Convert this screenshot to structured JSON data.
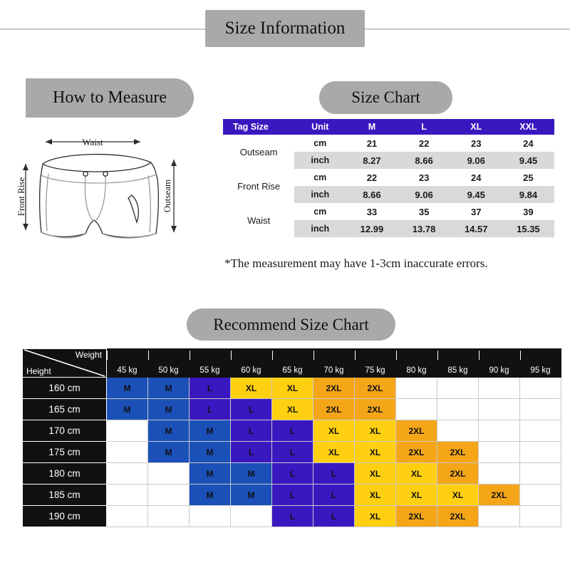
{
  "page": {
    "title": "Size Information"
  },
  "banners": {
    "how_to_measure": "How to Measure",
    "size_chart": "Size Chart",
    "recommend_size_chart": "Recommend Size Chart"
  },
  "measure_diagram": {
    "waist_label": "Waist",
    "front_rise_label": "Front Rise",
    "outseam_label": "Outseam"
  },
  "size_chart": {
    "headers": [
      "Tag Size",
      "Unit",
      "M",
      "L",
      "XL",
      "XXL"
    ],
    "rows": [
      {
        "label": "Outseam",
        "units": [
          {
            "unit": "cm",
            "values": [
              "21",
              "22",
              "23",
              "24"
            ]
          },
          {
            "unit": "inch",
            "values": [
              "8.27",
              "8.66",
              "9.06",
              "9.45"
            ]
          }
        ]
      },
      {
        "label": "Front Rise",
        "units": [
          {
            "unit": "cm",
            "values": [
              "22",
              "23",
              "24",
              "25"
            ]
          },
          {
            "unit": "inch",
            "values": [
              "8.66",
              "9.06",
              "9.45",
              "9.84"
            ]
          }
        ]
      },
      {
        "label": "Waist",
        "units": [
          {
            "unit": "cm",
            "values": [
              "33",
              "35",
              "37",
              "39"
            ]
          },
          {
            "unit": "inch",
            "values": [
              "12.99",
              "13.78",
              "14.57",
              "15.35"
            ]
          }
        ]
      }
    ],
    "disclaimer": "*The measurement may have 1-3cm inaccurate errors."
  },
  "recommend_chart": {
    "corner": {
      "weight": "Weight",
      "height": "Height"
    },
    "weights": [
      "45 kg",
      "50  kg",
      "55  kg",
      "60  kg",
      "65  kg",
      "70  kg",
      "75  kg",
      "80  kg",
      "85  kg",
      "90  kg",
      "95  kg"
    ],
    "heights": [
      "160 cm",
      "165 cm",
      "170 cm",
      "175 cm",
      "180 cm",
      "185 cm",
      "190 cm"
    ],
    "cells": [
      [
        "M",
        "M",
        "L",
        "XL",
        "XL",
        "2XL",
        "2XL",
        "",
        "",
        "",
        ""
      ],
      [
        "M",
        "M",
        "L",
        "L",
        "XL",
        "2XL",
        "2XL",
        "",
        "",
        "",
        ""
      ],
      [
        "",
        "M",
        "M",
        "L",
        "L",
        "XL",
        "XL",
        "2XL",
        "",
        "",
        ""
      ],
      [
        "",
        "M",
        "M",
        "L",
        "L",
        "XL",
        "XL",
        "2XL",
        "2XL",
        "",
        ""
      ],
      [
        "",
        "",
        "M",
        "M",
        "L",
        "L",
        "XL",
        "XL",
        "2XL",
        "",
        ""
      ],
      [
        "",
        "",
        "M",
        "M",
        "L",
        "L",
        "XL",
        "XL",
        "XL",
        "2XL",
        ""
      ],
      [
        "",
        "",
        "",
        "",
        "L",
        "L",
        "XL",
        "2XL",
        "2XL",
        "",
        ""
      ]
    ]
  },
  "colors": {
    "banner_gray": "#a9a9a9",
    "table_header_purple": "#3a18c0",
    "size_m": "#1a50b8",
    "size_l": "#3a18c0",
    "size_xl": "#ffd011",
    "size_2xl": "#f5a618",
    "row_shaded": "#d9d9d9",
    "grid_label_black": "#111111"
  }
}
